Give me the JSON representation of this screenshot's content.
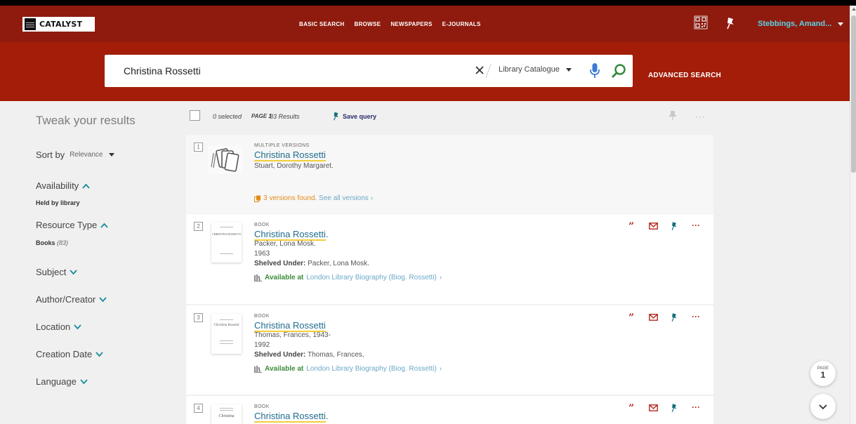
{
  "header": {
    "logo_text": "CATALYST",
    "nav": [
      "BASIC SEARCH",
      "BROWSE",
      "NEWSPAPERS",
      "E-JOURNALS"
    ],
    "user": "Stebbings, Amand..."
  },
  "search": {
    "query": "Christina Rossetti",
    "scope": "Library Catalogue",
    "advanced_label": "ADVANCED SEARCH"
  },
  "sidebar": {
    "title": "Tweak your results",
    "sort_label": "Sort by",
    "sort_value": "Relevance",
    "facets": [
      {
        "label": "Availability",
        "value": "Held by library",
        "count": ""
      },
      {
        "label": "Resource Type",
        "value": "Books",
        "count": "(83)"
      },
      {
        "label": "Subject"
      },
      {
        "label": "Author/Creator"
      },
      {
        "label": "Location"
      },
      {
        "label": "Creation Date"
      },
      {
        "label": "Language"
      }
    ]
  },
  "toolbar": {
    "selected": "0 selected",
    "page": "PAGE 1",
    "results": "83 Results",
    "save_query": "Save query",
    "more": "···"
  },
  "results": [
    {
      "num": "1",
      "type": "MULTIPLE VERSIONS",
      "title": "Christina Rossetti",
      "title_suffix": "",
      "author": "Stuart, Dorothy Margaret.",
      "versions_found": "3 versions found.",
      "versions_link": "See all versions"
    },
    {
      "num": "2",
      "type": "BOOK",
      "title": "Christina Rossetti",
      "title_suffix": ".",
      "author": "Packer, Lona Mosk.",
      "year": "1963",
      "shelved_label": "Shelved Under:",
      "shelved_value": "Packer, Lona Mosk.",
      "avail_status": "Available at",
      "avail_location": "London Library  Biography (Biog. Rossetti)",
      "thumb_caption": "CHRISTINA ROSSETTI"
    },
    {
      "num": "3",
      "type": "BOOK",
      "title": "Christina Rossetti",
      "title_suffix": "",
      "author": "Thomas, Frances, 1943-",
      "year": "1992",
      "shelved_label": "Shelved Under:",
      "shelved_value": "Thomas, Frances,",
      "avail_status": "Available at",
      "avail_location": "London Library  Biography (Biog. Rossetti)",
      "thumb_caption": "Christina Rossetti"
    },
    {
      "num": "4",
      "type": "BOOK",
      "title": "Christina Rossetti",
      "title_suffix": ".",
      "thumb_caption": "Christina"
    }
  ],
  "actions": {
    "quote": "”",
    "more": "···"
  },
  "pager": {
    "label": "PAGE",
    "number": "1"
  },
  "colors": {
    "topbar": "#8e1b0e",
    "searchband": "#a31d08",
    "link": "#1f6b8d",
    "action": "#b4281b",
    "pin": "#136d7a",
    "available": "#3c8c3c",
    "versions": "#e38b18",
    "user": "#5ad2e6"
  },
  "icons": [
    "qr-code-icon",
    "pin-icon",
    "clear-icon",
    "mic-icon",
    "search-icon",
    "chevron-up-icon",
    "chevron-down-icon",
    "quote-icon",
    "mail-icon",
    "more-icon",
    "versions-icon",
    "book-shelf-icon"
  ]
}
